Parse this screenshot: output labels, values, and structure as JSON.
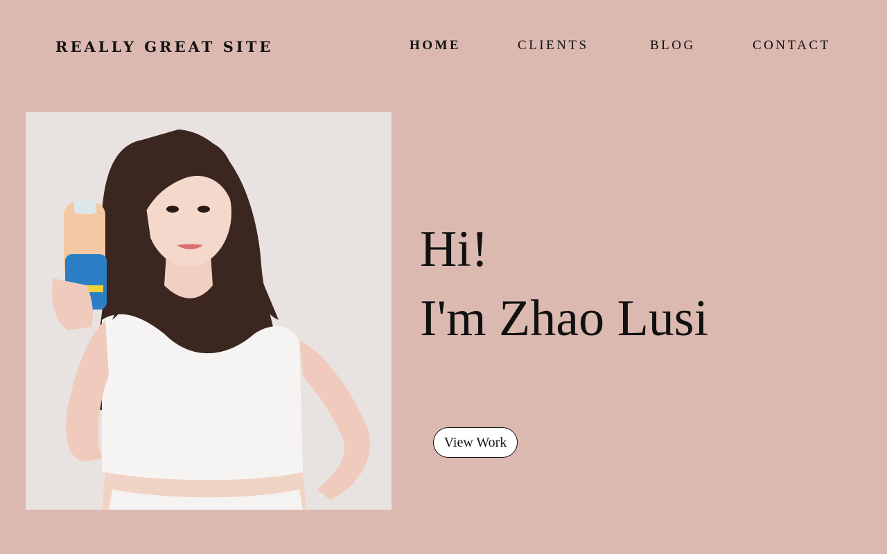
{
  "header": {
    "logo": "REALLY GREAT SITE",
    "nav": {
      "home": "HOME",
      "clients": "CLIENTS",
      "blog": "BLOG",
      "contact": "CONTACT"
    },
    "active_item": "HOME"
  },
  "hero": {
    "greeting_line1": "Hi!",
    "greeting_line2": "I'm Zhao Lusi",
    "cta_label": "View Work",
    "photo_subject": "portrait-photo"
  },
  "colors": {
    "background": "#dcb9b0",
    "text": "#111111",
    "photo_background": "#e8e3e0",
    "button_background": "#ffffff"
  }
}
